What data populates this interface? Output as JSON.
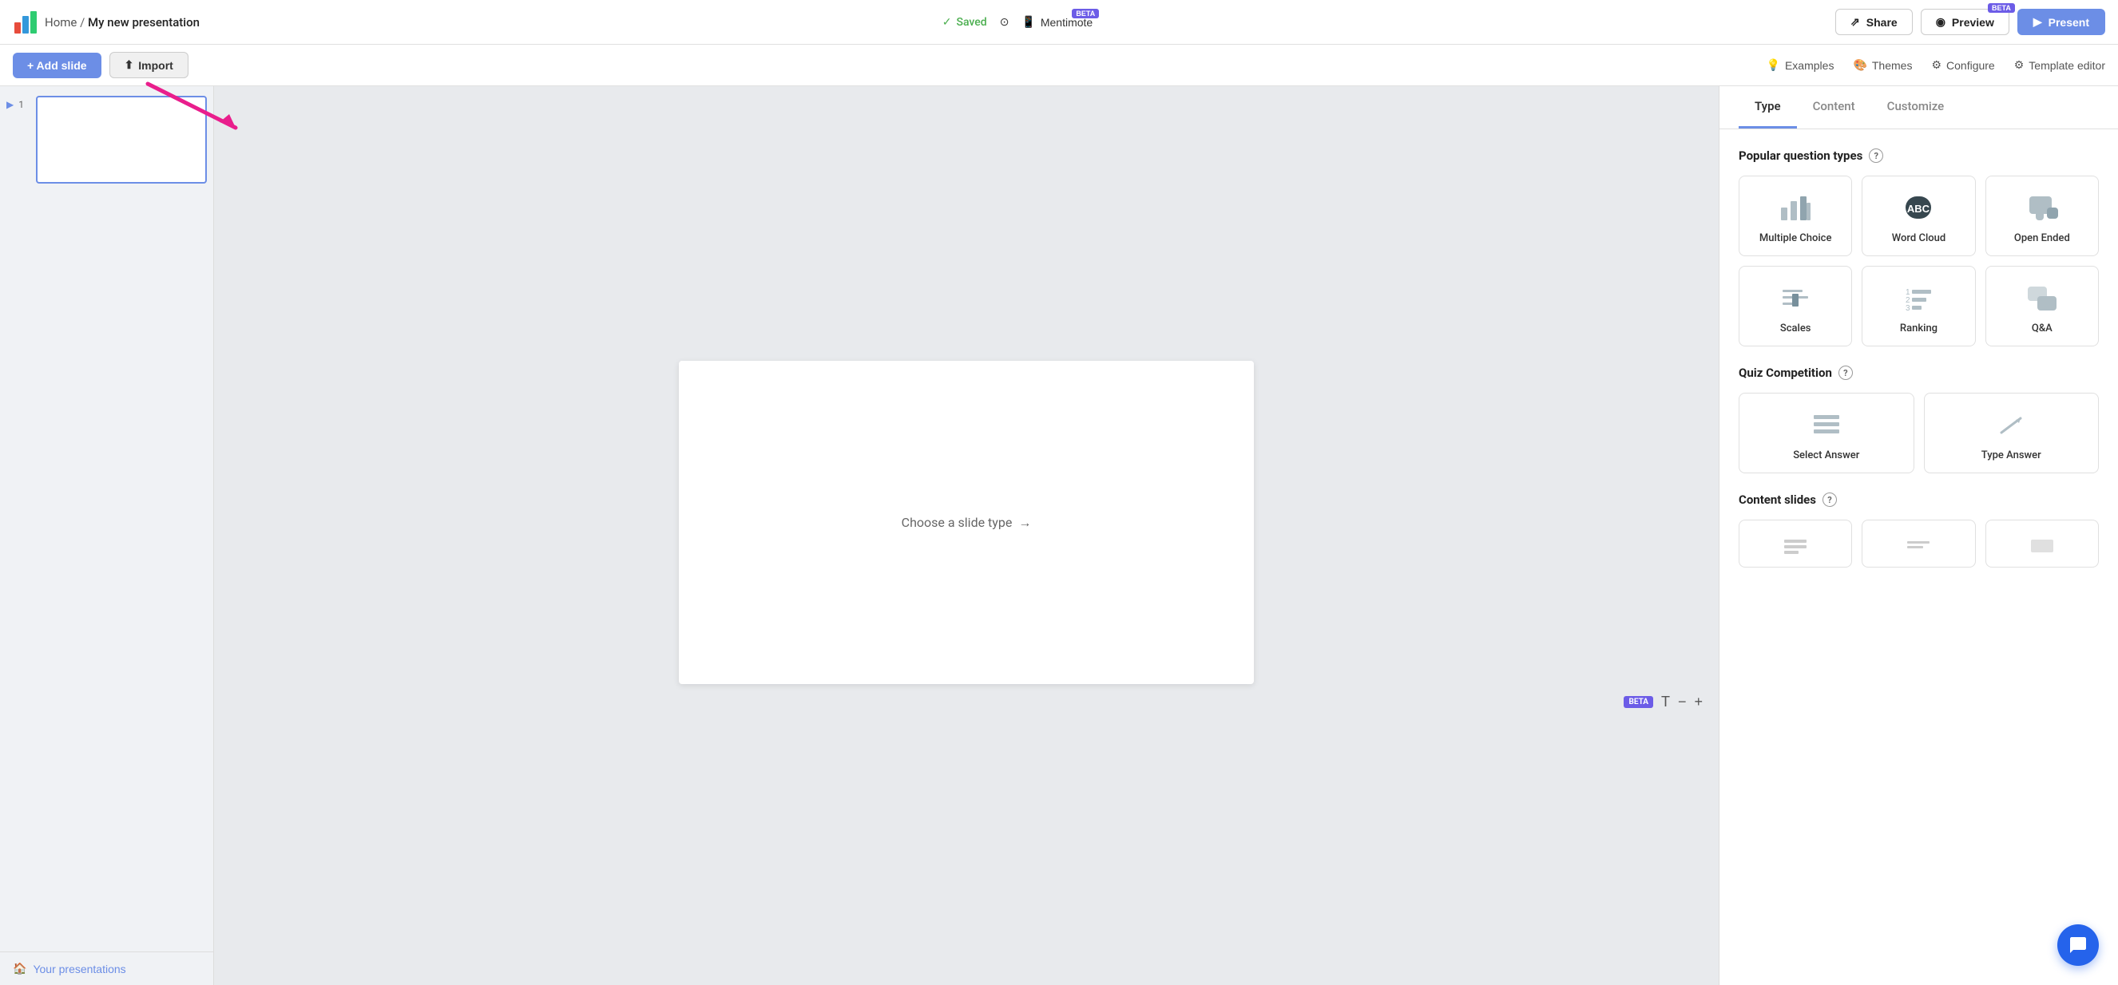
{
  "nav": {
    "home": "Home",
    "separator": "/",
    "presentation_name": "My new presentation",
    "saved_text": "Saved",
    "help_label": "",
    "mentimote_label": "Mentimote",
    "beta_label": "BETA",
    "share_label": "Share",
    "preview_label": "Preview",
    "present_label": "Present"
  },
  "toolbar": {
    "add_slide_label": "+ Add slide",
    "import_label": "Import",
    "examples_label": "Examples",
    "themes_label": "Themes",
    "configure_label": "Configure",
    "template_editor_label": "Template editor"
  },
  "sidebar": {
    "slide_number": "1",
    "your_presentations_label": "Your presentations"
  },
  "canvas": {
    "choose_slide_text": "Choose a slide type",
    "arrow_label": "→",
    "beta_label": "BETA"
  },
  "right_panel": {
    "tabs": [
      {
        "id": "type",
        "label": "Type",
        "active": true
      },
      {
        "id": "content",
        "label": "Content",
        "active": false
      },
      {
        "id": "customize",
        "label": "Customize",
        "active": false
      }
    ],
    "popular_section_title": "Popular question types",
    "quiz_section_title": "Quiz Competition",
    "content_section_title": "Content slides",
    "popular_types": [
      {
        "id": "multiple-choice",
        "label": "Multiple Choice"
      },
      {
        "id": "word-cloud",
        "label": "Word Cloud"
      },
      {
        "id": "open-ended",
        "label": "Open Ended"
      },
      {
        "id": "scales",
        "label": "Scales"
      },
      {
        "id": "ranking",
        "label": "Ranking"
      },
      {
        "id": "qna",
        "label": "Q&A"
      }
    ],
    "quiz_types": [
      {
        "id": "select-answer",
        "label": "Select Answer"
      },
      {
        "id": "type-answer",
        "label": "Type Answer"
      }
    ]
  }
}
